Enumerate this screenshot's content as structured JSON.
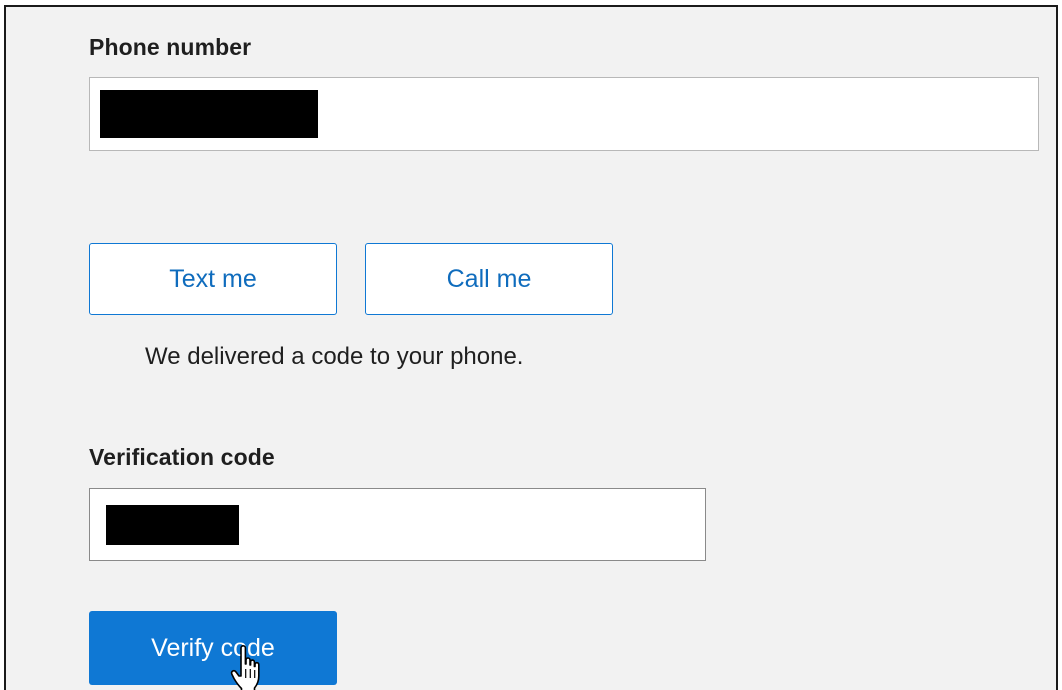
{
  "phone": {
    "label": "Phone number",
    "value": ""
  },
  "buttons": {
    "text_me": "Text me",
    "call_me": "Call me",
    "verify": "Verify code"
  },
  "status_message": "We delivered a code to your phone.",
  "verification": {
    "label": "Verification code",
    "value": ""
  },
  "icons": {
    "cursor": "hand-pointer-icon"
  },
  "colors": {
    "accent": "#0f78d4",
    "panel_bg": "#f2f2f2"
  }
}
